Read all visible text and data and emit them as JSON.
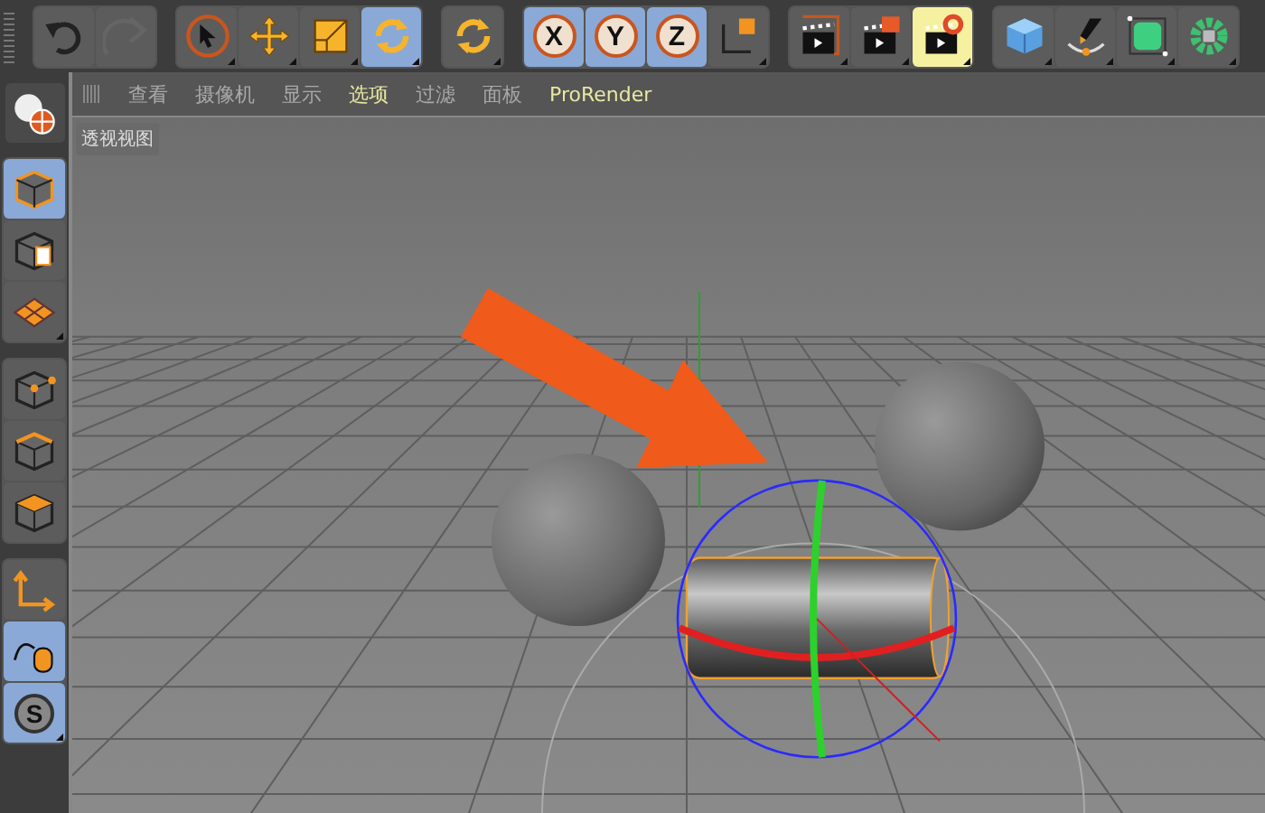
{
  "top_toolbar": {
    "groups": [
      {
        "tools": [
          {
            "kind": "undo",
            "selected": false,
            "disabled": false
          },
          {
            "kind": "redo",
            "selected": false,
            "disabled": true
          }
        ]
      },
      {
        "tools": [
          {
            "kind": "select",
            "selected": false,
            "disabled": false
          },
          {
            "kind": "move",
            "selected": false,
            "disabled": false
          },
          {
            "kind": "scale",
            "selected": false,
            "disabled": false
          },
          {
            "kind": "rotate",
            "selected": true,
            "disabled": false
          }
        ]
      },
      {
        "tools": [
          {
            "kind": "rotate",
            "selected": false,
            "disabled": false
          }
        ]
      },
      {
        "tools": [
          {
            "kind": "axis",
            "label": "X",
            "selected": true,
            "disabled": false
          },
          {
            "kind": "axis",
            "label": "Y",
            "selected": true,
            "disabled": false
          },
          {
            "kind": "axis",
            "label": "Z",
            "selected": true,
            "disabled": false
          },
          {
            "kind": "coord",
            "selected": false,
            "disabled": false
          }
        ]
      },
      {
        "tools": [
          {
            "kind": "render-view",
            "selected": false,
            "disabled": false
          },
          {
            "kind": "render-picture",
            "selected": false,
            "disabled": false
          },
          {
            "kind": "render-settings",
            "selected": true,
            "disabled": false
          }
        ]
      },
      {
        "tools": [
          {
            "kind": "cube",
            "selected": false,
            "disabled": false
          },
          {
            "kind": "pen",
            "selected": false,
            "disabled": false
          },
          {
            "kind": "subdiv",
            "selected": false,
            "disabled": false
          },
          {
            "kind": "cloner",
            "selected": false,
            "disabled": false
          }
        ]
      }
    ]
  },
  "menu": [
    {
      "label": "查看",
      "highlighted": false
    },
    {
      "label": "摄像机",
      "highlighted": false
    },
    {
      "label": "显示",
      "highlighted": false
    },
    {
      "label": "选项",
      "highlighted": true
    },
    {
      "label": "过滤",
      "highlighted": false
    },
    {
      "label": "面板",
      "highlighted": false
    },
    {
      "label": "ProRender",
      "highlighted": true
    }
  ],
  "viewport": {
    "title": "透视视图"
  },
  "left_toolbar": {
    "groups": [
      {
        "tools": [
          {
            "kind": "model",
            "selected": true
          },
          {
            "kind": "texture",
            "selected": false
          },
          {
            "kind": "workplane",
            "selected": false
          }
        ]
      },
      {
        "tools": [
          {
            "kind": "points",
            "selected": false
          },
          {
            "kind": "edges",
            "selected": false
          },
          {
            "kind": "polygons",
            "selected": false
          }
        ]
      },
      {
        "tools": [
          {
            "kind": "axis-mode",
            "selected": false
          },
          {
            "kind": "tweak",
            "selected": true
          },
          {
            "kind": "snap",
            "label": "S",
            "selected": true
          }
        ]
      }
    ]
  }
}
